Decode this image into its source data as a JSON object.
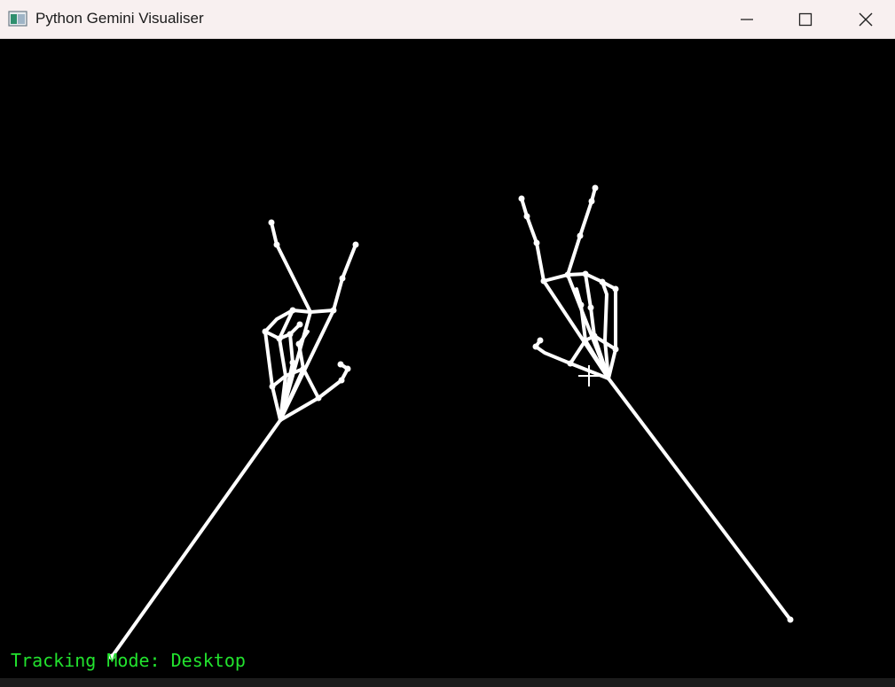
{
  "window": {
    "title": "Python Gemini Visualiser",
    "icon": "app-window-icon",
    "controls": [
      "minimize-icon",
      "maximize-icon",
      "close-icon"
    ]
  },
  "canvas": {
    "background": "#000000",
    "skeleton_color": "#ffffff",
    "status_color": "#22e22e",
    "status_text": "Tracking Mode: Desktop"
  }
}
